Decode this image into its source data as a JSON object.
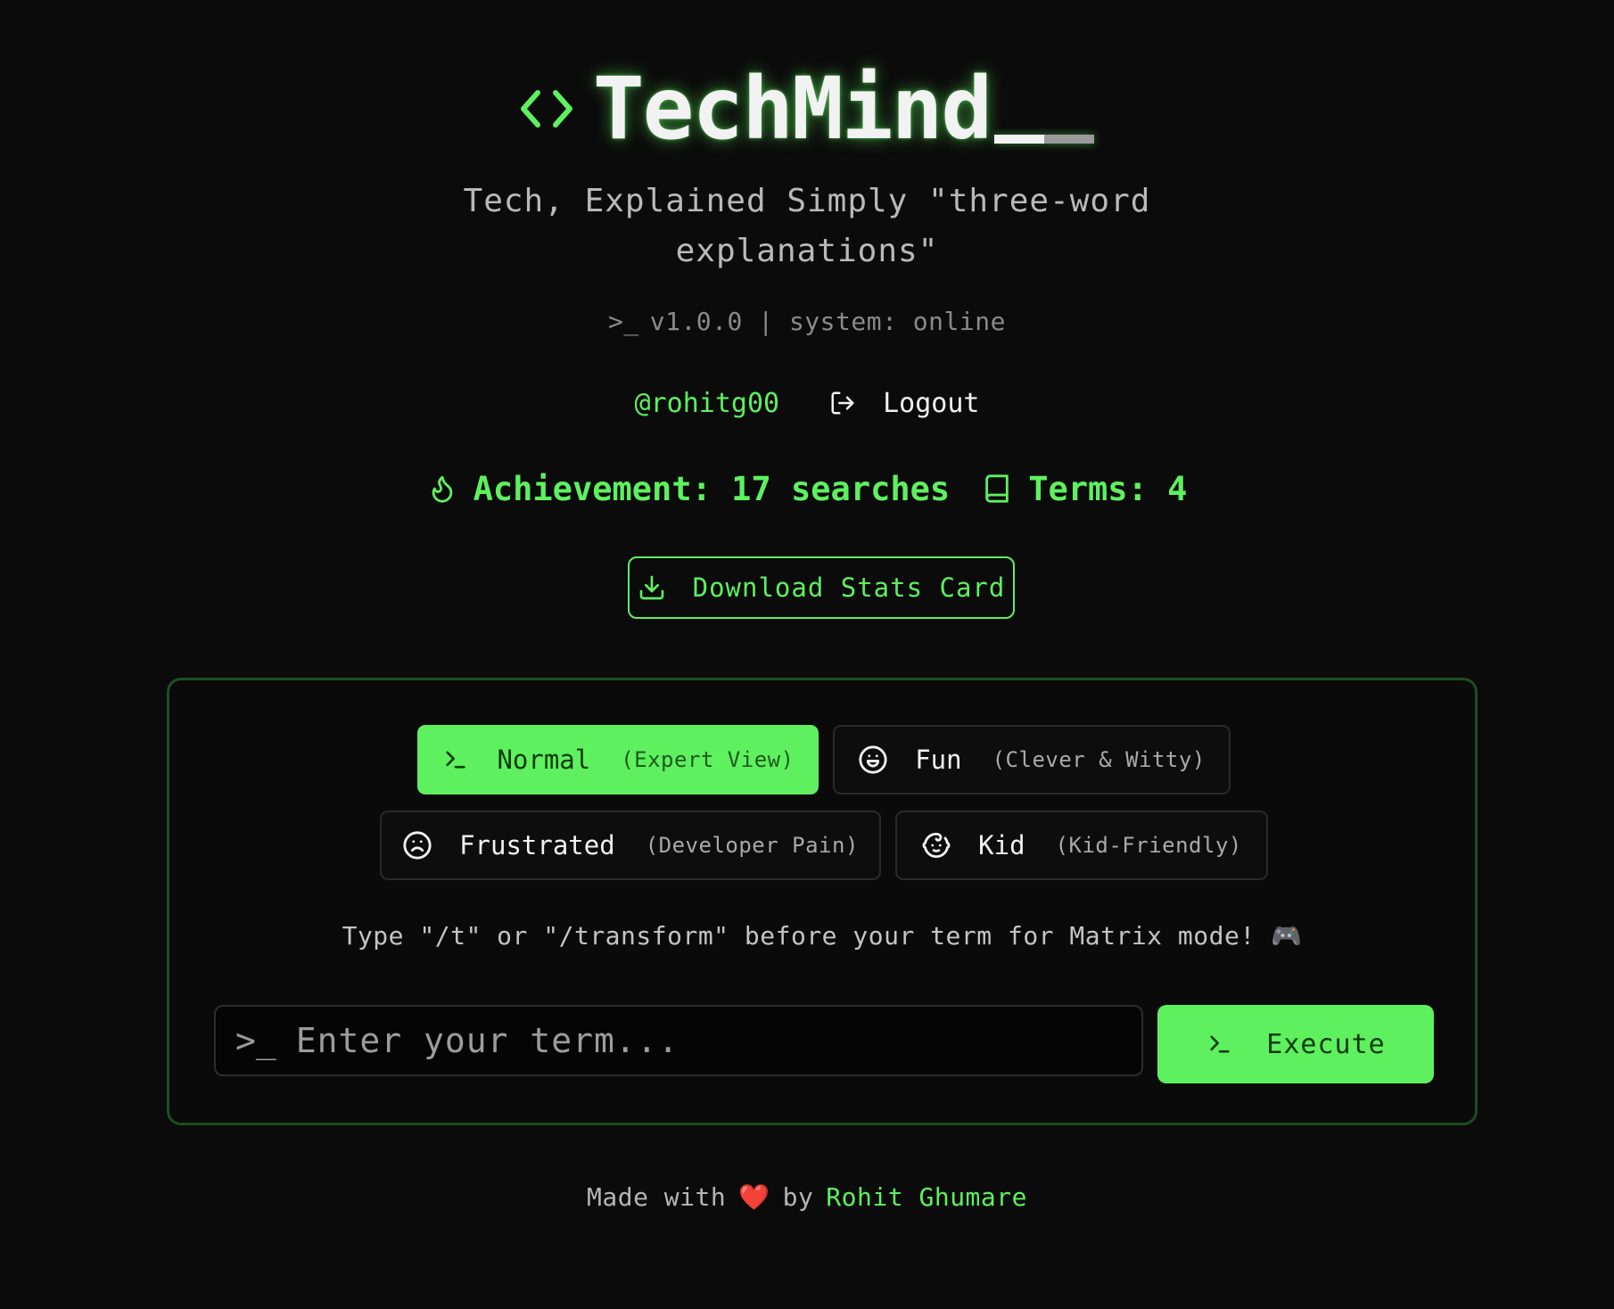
{
  "brand": {
    "title": "TechMind",
    "icon": "code-brackets-icon"
  },
  "header": {
    "subtitle": "Tech, Explained Simply \"three-word explanations\"",
    "version_prompt": ">_",
    "version_text": "v1.0.0 | system: online"
  },
  "user": {
    "username": "@rohitg00",
    "logout_label": "Logout"
  },
  "stats": {
    "achievement_label": "Achievement: 17 searches",
    "terms_label": "Terms: 4"
  },
  "download": {
    "label": "Download Stats Card"
  },
  "modes": [
    {
      "name": "Normal",
      "sub": "(Expert View)",
      "icon": "terminal-icon",
      "active": true
    },
    {
      "name": "Fun",
      "sub": "(Clever & Witty)",
      "icon": "smile-icon",
      "active": false
    },
    {
      "name": "Frustrated",
      "sub": "(Developer Pain)",
      "icon": "frown-icon",
      "active": false
    },
    {
      "name": "Kid",
      "sub": "(Kid-Friendly)",
      "icon": "baby-icon",
      "active": false
    }
  ],
  "hint": "Type \"/t\" or \"/transform\" before your term for Matrix mode! 🎮",
  "search": {
    "prompt": ">_",
    "placeholder": "Enter your term...",
    "value": ""
  },
  "execute": {
    "label": "Execute"
  },
  "footer": {
    "prefix": "Made with",
    "heart": "❤️",
    "by": "by",
    "author": "Rohit Ghumare"
  },
  "colors": {
    "accent": "#5ef05e",
    "background": "#0b0b0b",
    "panel_border": "#1f4d1f"
  }
}
